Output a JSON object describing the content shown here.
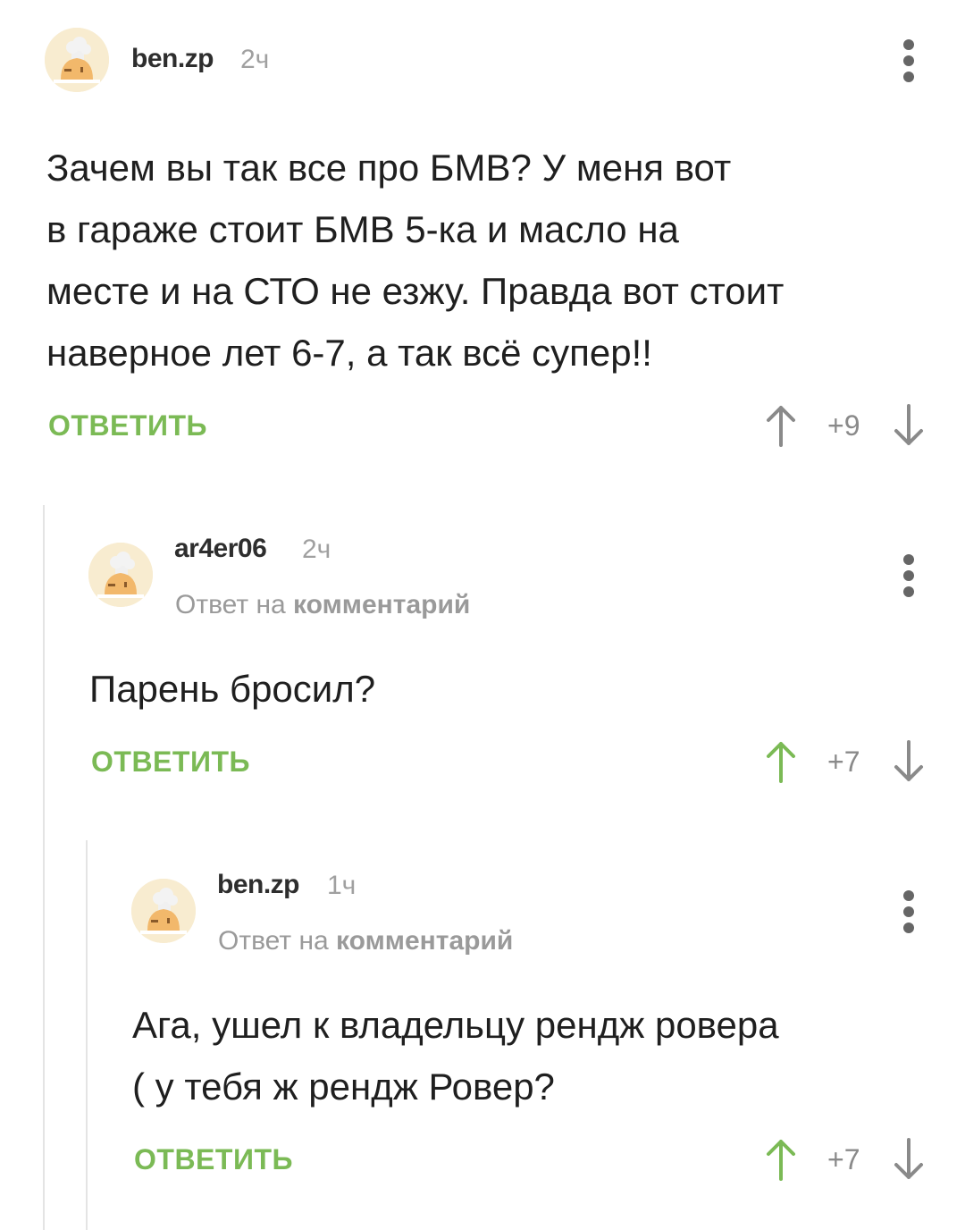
{
  "comments": [
    {
      "author": "ben.zp",
      "time": "2ч",
      "reply_to": null,
      "text_lines": [
        "Зачем вы так все про БМВ? У меня вот",
        "в гараже стоит БМВ 5-ка и масло на",
        "месте и на СТО не езжу. Правда вот стоит",
        "наверное лет 6-7, а так всё супер!!"
      ],
      "reply_label": "ОТВЕТИТЬ",
      "rating": "+9",
      "upvoted": false
    },
    {
      "author": "ar4er06",
      "time": "2ч",
      "reply_to": {
        "prefix": "Ответ на",
        "target": "комментарий"
      },
      "text_lines": [
        "Парень бросил?"
      ],
      "reply_label": "ОТВЕТИТЬ",
      "rating": "+7",
      "upvoted": true
    },
    {
      "author": "ben.zp",
      "time": "1ч",
      "reply_to": {
        "prefix": "Ответ на",
        "target": "комментарий"
      },
      "text_lines": [
        "Ага, ушел к владельцу рендж ровера",
        "( у тебя ж рендж Ровер?"
      ],
      "reply_label": "ОТВЕТИТЬ",
      "rating": "+7",
      "upvoted": true
    }
  ],
  "colors": {
    "accent_green": "#7bba55",
    "vote_gray": "#8a8a8a",
    "thread_line": "#e4e4e4"
  },
  "icons": {
    "menu": "vertical-dots-icon",
    "upvote": "arrow-up-icon",
    "downvote": "arrow-down-icon",
    "avatar": "default-avatar-icon"
  }
}
